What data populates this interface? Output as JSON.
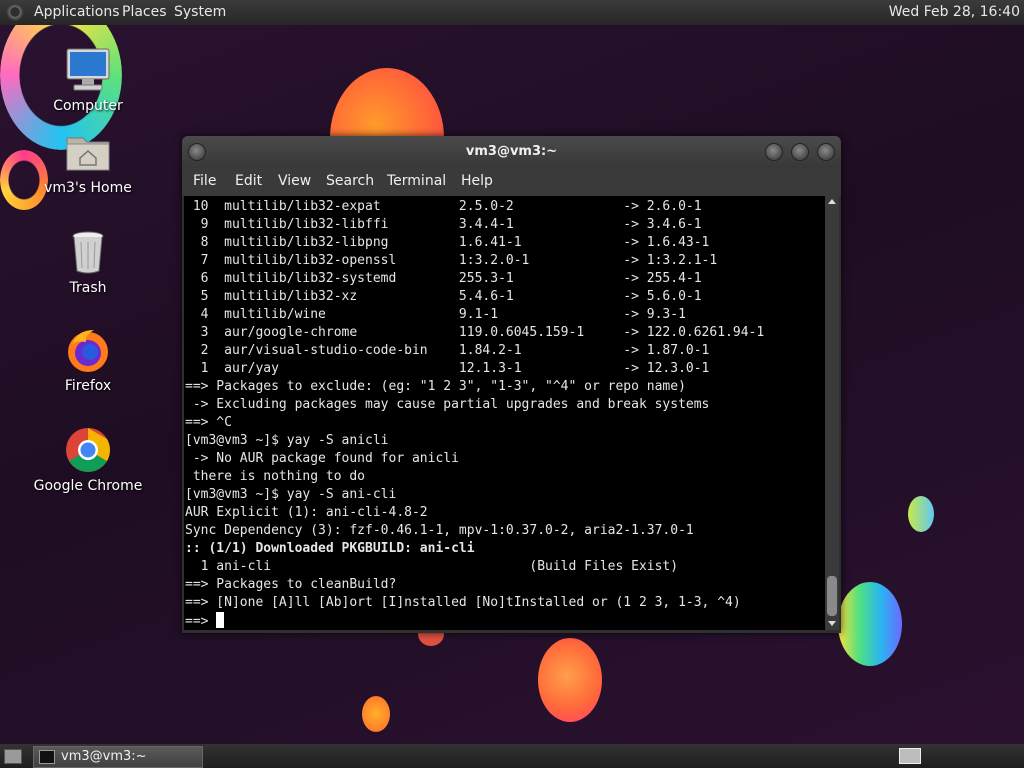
{
  "top_panel": {
    "menus": [
      "Applications",
      "Places",
      "System"
    ],
    "clock": "Wed Feb 28, 16:40"
  },
  "desktop": {
    "icons": [
      {
        "label": "Computer",
        "icon": "computer-icon"
      },
      {
        "label": "vm3's Home",
        "icon": "home-folder-icon"
      },
      {
        "label": "Trash",
        "icon": "trash-icon"
      },
      {
        "label": "Firefox",
        "icon": "firefox-icon"
      },
      {
        "label": "Google Chrome",
        "icon": "chrome-icon"
      }
    ]
  },
  "terminal": {
    "title": "vm3@vm3:~",
    "menu": [
      "File",
      "Edit",
      "View",
      "Search",
      "Terminal",
      "Help"
    ],
    "lines": [
      {
        "text": " 10  multilib/lib32-expat          2.5.0-2              -> 2.6.0-1"
      },
      {
        "text": "  9  multilib/lib32-libffi         3.4.4-1              -> 3.4.6-1"
      },
      {
        "text": "  8  multilib/lib32-libpng         1.6.41-1             -> 1.6.43-1"
      },
      {
        "text": "  7  multilib/lib32-openssl        1:3.2.0-1            -> 1:3.2.1-1"
      },
      {
        "text": "  6  multilib/lib32-systemd        255.3-1              -> 255.4-1"
      },
      {
        "text": "  5  multilib/lib32-xz             5.4.6-1              -> 5.6.0-1"
      },
      {
        "text": "  4  multilib/wine                 9.1-1                -> 9.3-1"
      },
      {
        "text": "  3  aur/google-chrome             119.0.6045.159-1     -> 122.0.6261.94-1"
      },
      {
        "text": "  2  aur/visual-studio-code-bin    1.84.2-1             -> 1.87.0-1"
      },
      {
        "text": "  1  aur/yay                       12.1.3-1             -> 12.3.0-1"
      },
      {
        "text": "==> Packages to exclude: (eg: \"1 2 3\", \"1-3\", \"^4\" or repo name)"
      },
      {
        "text": " -> Excluding packages may cause partial upgrades and break systems"
      },
      {
        "text": "==> ^C"
      },
      {
        "text": "[vm3@vm3 ~]$ yay -S anicli"
      },
      {
        "text": " -> No AUR package found for anicli"
      },
      {
        "text": " there is nothing to do"
      },
      {
        "text": "[vm3@vm3 ~]$ yay -S ani-cli"
      },
      {
        "text": "AUR Explicit (1): ani-cli-4.8-2"
      },
      {
        "text": "Sync Dependency (3): fzf-0.46.1-1, mpv-1:0.37.0-2, aria2-1.37.0-1"
      },
      {
        "text": ":: (1/1) Downloaded PKGBUILD: ani-cli",
        "bold": true
      },
      {
        "text": "  1 ani-cli                                 (Build Files Exist)"
      },
      {
        "text": "==> Packages to cleanBuild?"
      },
      {
        "text": "==> [N]one [A]ll [Ab]ort [I]nstalled [No]tInstalled or (1 2 3, 1-3, ^4)"
      },
      {
        "text": "==> ",
        "cursor": true
      }
    ]
  },
  "taskbar": {
    "window_label": "vm3@vm3:~"
  }
}
